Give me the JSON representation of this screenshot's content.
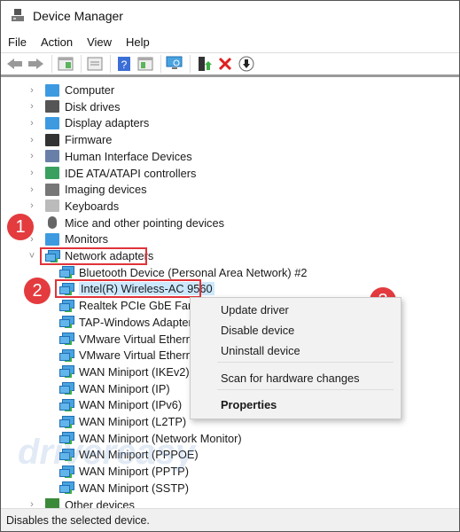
{
  "window": {
    "title": "Device Manager"
  },
  "menu": [
    "File",
    "Action",
    "View",
    "Help"
  ],
  "toolbar": {
    "buttons": [
      "back-icon",
      "forward-icon",
      "console-tree-icon",
      "properties-icon",
      "help-icon",
      "action-pane-icon",
      "scan-hardware-icon",
      "update-driver-icon",
      "uninstall-icon",
      "disable-icon"
    ]
  },
  "tree": {
    "categories": [
      {
        "label": "Computer",
        "icon": "computer-icon"
      },
      {
        "label": "Disk drives",
        "icon": "disk-icon"
      },
      {
        "label": "Display adapters",
        "icon": "display-icon"
      },
      {
        "label": "Firmware",
        "icon": "firmware-icon"
      },
      {
        "label": "Human Interface Devices",
        "icon": "hid-icon"
      },
      {
        "label": "IDE ATA/ATAPI controllers",
        "icon": "ide-icon"
      },
      {
        "label": "Imaging devices",
        "icon": "camera-icon"
      },
      {
        "label": "Keyboards",
        "icon": "keyboard-icon"
      },
      {
        "label": "Mice and other pointing devices",
        "icon": "mouse-icon"
      },
      {
        "label": "Monitors",
        "icon": "monitor-icon"
      },
      {
        "label": "Network adapters",
        "icon": "network-icon",
        "expanded": true
      }
    ],
    "network_adapters": [
      "Bluetooth Device (Personal Area Network) #2",
      "Intel(R) Wireless-AC 9560",
      "Realtek PCIe GbE Famil",
      "TAP-Windows Adapter",
      "VMware Virtual Etherne",
      "VMware Virtual Etherne",
      "WAN Miniport (IKEv2)",
      "WAN Miniport (IP)",
      "WAN Miniport (IPv6)",
      "WAN Miniport (L2TP)",
      "WAN Miniport (Network Monitor)",
      "WAN Miniport (PPPOE)",
      "WAN Miniport (PPTP)",
      "WAN Miniport (SSTP)"
    ],
    "selected": "Intel(R) Wireless-AC 9560",
    "trailing": "Other devices"
  },
  "context_menu": {
    "items": [
      "Update driver",
      "Disable device",
      "Uninstall device",
      "Scan for hardware changes",
      "Properties"
    ]
  },
  "badges": [
    "1",
    "2",
    "3"
  ],
  "status": "Disables the selected device.",
  "watermark": "drivereasy",
  "colors": {
    "highlight": "#e0333a",
    "badge": "#e33b3e",
    "selection": "#cce8ff"
  }
}
